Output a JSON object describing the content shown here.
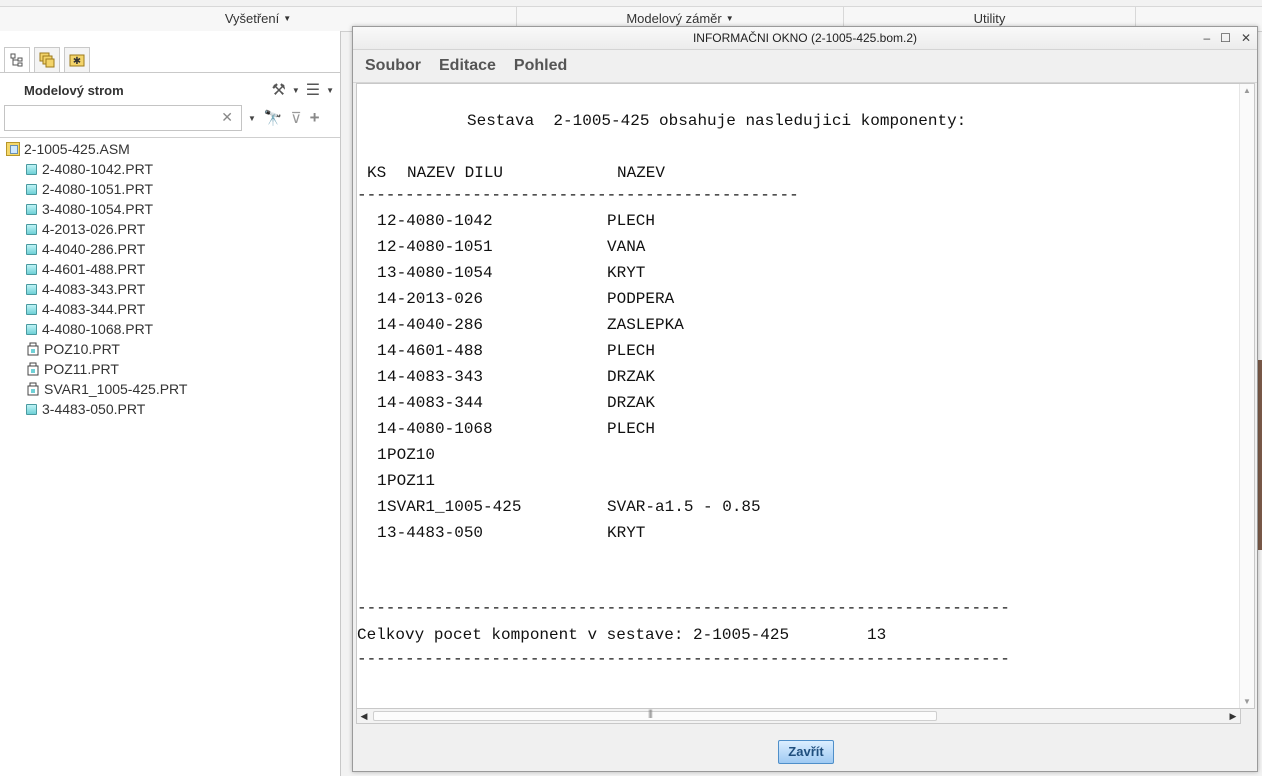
{
  "ribbon": {
    "tabs": [
      "Vyšetření",
      "Modelový záměr",
      "Utility"
    ]
  },
  "left_panel": {
    "tree_title": "Modelový strom",
    "search_value": "",
    "tabs": [
      "model-tree-icon",
      "layers-icon",
      "favorites-icon"
    ]
  },
  "tree": {
    "root": "2-1005-425.ASM",
    "items": [
      {
        "label": "2-4080-1042.PRT",
        "icon": "part-icon"
      },
      {
        "label": "2-4080-1051.PRT",
        "icon": "part-icon"
      },
      {
        "label": "3-4080-1054.PRT",
        "icon": "part-icon"
      },
      {
        "label": "4-2013-026.PRT",
        "icon": "part-icon"
      },
      {
        "label": "4-4040-286.PRT",
        "icon": "part-icon"
      },
      {
        "label": "4-4601-488.PRT",
        "icon": "part-icon"
      },
      {
        "label": "4-4083-343.PRT",
        "icon": "part-icon"
      },
      {
        "label": "4-4083-344.PRT",
        "icon": "part-icon"
      },
      {
        "label": "4-4080-1068.PRT",
        "icon": "part-icon"
      },
      {
        "label": "POZ10.PRT",
        "icon": "bulk-part-icon"
      },
      {
        "label": "POZ11.PRT",
        "icon": "bulk-part-icon"
      },
      {
        "label": "SVAR1_1005-425.PRT",
        "icon": "bulk-part-icon"
      },
      {
        "label": "3-4483-050.PRT",
        "icon": "part-icon"
      }
    ]
  },
  "info_window": {
    "title": "INFORMAČNI OKNO (2-1005-425.bom.2)",
    "menu": [
      "Soubor",
      "Editace",
      "Pohled"
    ],
    "header_line": "Sestava  2-1005-425 obsahuje nasledujici komponenty:",
    "col_ks": "KS",
    "col_nazev_dilu": "NAZEV DILU",
    "col_nazev": "NAZEV",
    "sep_short": "----------------------------------------------",
    "rows": [
      {
        "ks": "1",
        "part": "2-4080-1042",
        "name": "PLECH"
      },
      {
        "ks": "1",
        "part": "2-4080-1051",
        "name": "VANA"
      },
      {
        "ks": "1",
        "part": "3-4080-1054",
        "name": "KRYT"
      },
      {
        "ks": "1",
        "part": "4-2013-026",
        "name": "PODPERA"
      },
      {
        "ks": "1",
        "part": "4-4040-286",
        "name": "ZASLEPKA"
      },
      {
        "ks": "1",
        "part": "4-4601-488",
        "name": "PLECH"
      },
      {
        "ks": "1",
        "part": "4-4083-343",
        "name": "DRZAK"
      },
      {
        "ks": "1",
        "part": "4-4083-344",
        "name": "DRZAK"
      },
      {
        "ks": "1",
        "part": "4-4080-1068",
        "name": "PLECH"
      },
      {
        "ks": "1",
        "part": "POZ10",
        "name": ""
      },
      {
        "ks": "1",
        "part": "POZ11",
        "name": ""
      },
      {
        "ks": "1",
        "part": "SVAR1_1005-425",
        "name": "SVAR-a1.5 - 0.85"
      },
      {
        "ks": "1",
        "part": "3-4483-050",
        "name": "KRYT"
      }
    ],
    "sep_long": "--------------------------------------------------------------------",
    "total_label": "Celkovy pocet komponent v sestave: 2-1005-425",
    "total_value": "13",
    "close_button": "Zavřít"
  }
}
